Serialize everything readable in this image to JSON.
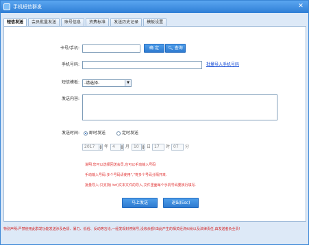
{
  "window": {
    "title": "手机短信群发",
    "close_glyph": "✕"
  },
  "tabs": [
    {
      "label": "短信发送",
      "active": true
    },
    {
      "label": "会员批量发送",
      "active": false
    },
    {
      "label": "账号信息",
      "active": false
    },
    {
      "label": "资费标准",
      "active": false
    },
    {
      "label": "发送历史记录",
      "active": false
    },
    {
      "label": "模板设置",
      "active": false
    }
  ],
  "form": {
    "card_label": "卡号/手机:",
    "card_value": "",
    "confirm_button": "确 定",
    "query_button": "查询",
    "mobile_label": "手机号码:",
    "mobile_value": "",
    "import_link": "批量导入手机号码",
    "template_label": "短信模板:",
    "template_selected": "-请选择-",
    "content_label": "发送内容:",
    "content_value": "",
    "send_time_label": "发送时间:",
    "send_now_label": "即时发送",
    "send_timed_label": "定时发送",
    "send_mode_selected": "即时发送",
    "date": {
      "year": "2017",
      "year_unit": "年",
      "month": "4",
      "month_unit": "月",
      "day": "10",
      "day_unit": "日",
      "hour": "17",
      "hour_unit": "时",
      "minute": "07",
      "minute_unit": "分"
    }
  },
  "hints": [
    "说明:您可以选择回送会员,也可以手动输入号码",
    "手动输入号码:多个号码请使用\",\"将多个号码分隔开来.",
    "批量导入:只支持(.txt)文本文件的导入,文件里面每个手机号码要换行填写."
  ],
  "actions": {
    "send_button": "马上发送",
    "exit_button": "退出(Esc)"
  },
  "footer_note": "特别声明:严禁使用此群发功能发送涉及色情、暴力、低俗、反动等言论,一经发现封停账号,没收余额!由此产生的相关经济纠纷以及法律责任,由发送者负全责!",
  "colors": {
    "accent": "#2f7fd6",
    "warning": "#e03030",
    "link": "#1a4fd6"
  }
}
